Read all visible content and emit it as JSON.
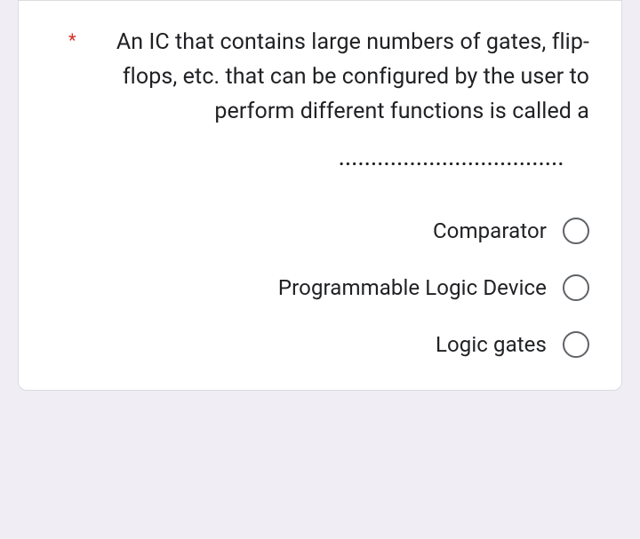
{
  "question": {
    "required_marker": "*",
    "text": "An IC that contains large numbers of gates, flip-flops, etc. that can be configured by the user to perform different functions is called a",
    "blank": "..................................."
  },
  "options": [
    {
      "label": "Comparator"
    },
    {
      "label": "Programmable Logic Device"
    },
    {
      "label": "Logic gates"
    }
  ]
}
